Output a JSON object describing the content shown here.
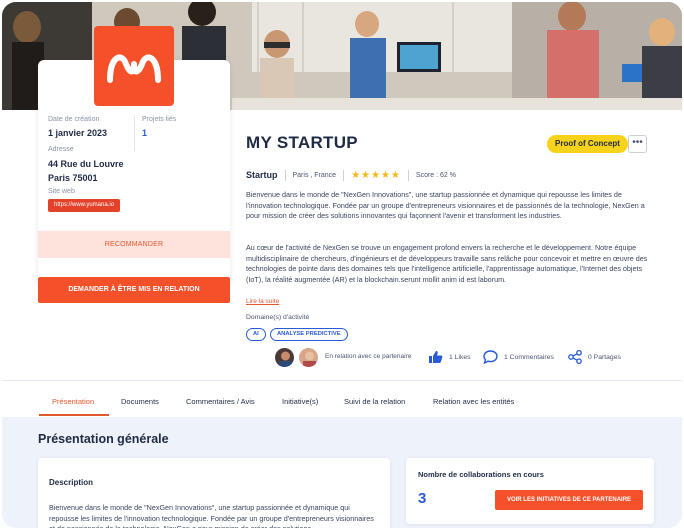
{
  "company": {
    "name": "MY STARTUP",
    "status": "Proof of Concept",
    "type": "Startup",
    "location": "Paris , France",
    "rating": 5,
    "stars": "★★★★★",
    "score": "Score : 62 %",
    "more_label": "•••"
  },
  "info": {
    "creation_date_label": "Date de création",
    "creation_date": "1 janvier 2023",
    "projects_label": "Projets liés",
    "projects_count": "1",
    "address_label": "Adresse",
    "address_line1": "44 Rue du Louvre",
    "address_line2": "Paris 75001",
    "website_label": "Site web",
    "website": "https://www.yumana.io"
  },
  "actions": {
    "recommend": "RECOMMANDER",
    "request_contact": "DEMANDER À ÊTRE MIS EN RELATION"
  },
  "description": {
    "paragraph1": "Bienvenue dans le monde de \"NexGen Innovations\", une startup passionnée et dynamique qui repousse les limites de l'innovation technologique. Fondée par un groupe d'entrepreneurs visionnaires et de passionnés de la technologie, NexGen a pour mission de créer des solutions innovantes qui façonnent l'avenir et transforment les industries.",
    "paragraph2": "Au cœur de l'activité de NexGen se trouve un engagement profond envers la recherche et le développement. Notre équipe multidisciplinaire de chercheurs, d'ingénieurs et de développeurs travaille sans relâche pour concevoir et mettre en œuvre des technologies de pointe dans des domaines tels que l'intelligence artificielle, l'apprentissage automatique, l'Internet des objets (IoT), la réalité augmentée (AR) et la blockchain.serunt mollit anim id est laborum.",
    "read_more": "Lire la suite"
  },
  "domains": {
    "label": "Domaine(s) d'activité",
    "tags": [
      "AI",
      "ANALYSE PREDICTIVE"
    ]
  },
  "social": {
    "relation_text": "En relation avec ce partenaire",
    "likes": "1 Likes",
    "comments": "1 Commentaires",
    "shares": "0 Partages"
  },
  "tabs": [
    {
      "label": "Présentation",
      "active": true
    },
    {
      "label": "Documents",
      "active": false
    },
    {
      "label": "Commentaires / Avis",
      "active": false
    },
    {
      "label": "Initiative(s)",
      "active": false
    },
    {
      "label": "Suivi de la relation",
      "active": false
    },
    {
      "label": "Relation avec les entités",
      "active": false
    }
  ],
  "overview": {
    "title": "Présentation générale",
    "description_title": "Description",
    "description_text": "Bienvenue dans le monde de \"NexGen Innovations\", une startup passionnée et dynamique qui repousse les limites de l'innovation technologique. Fondée par un groupe d'entrepreneurs visionnaires et de passionnés de la technologie, NexGen a pour mission de créer des solutions",
    "collab_title": "Nombre de collaborations en cours",
    "collab_count": "3",
    "collab_button": "VOIR LES INITIATIVES DE CE PARTENAIRE"
  },
  "colors": {
    "accent": "#f4502a",
    "link": "#2a5bd7",
    "status": "#f6d21a",
    "star": "#f6b81a"
  }
}
